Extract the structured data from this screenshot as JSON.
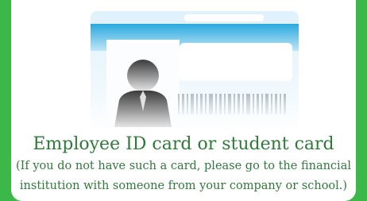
{
  "card": {
    "title": "Employee ID card or student card",
    "note_line1": "(If you do not have such a card, please go to the financial",
    "note_line2": "institution with someone from your company or school.)",
    "illustration_icon": "id-card-icon"
  },
  "colors": {
    "background": "#3cb84a",
    "text": "#2f7a3a",
    "card_stripe": "#2aa8dd"
  }
}
